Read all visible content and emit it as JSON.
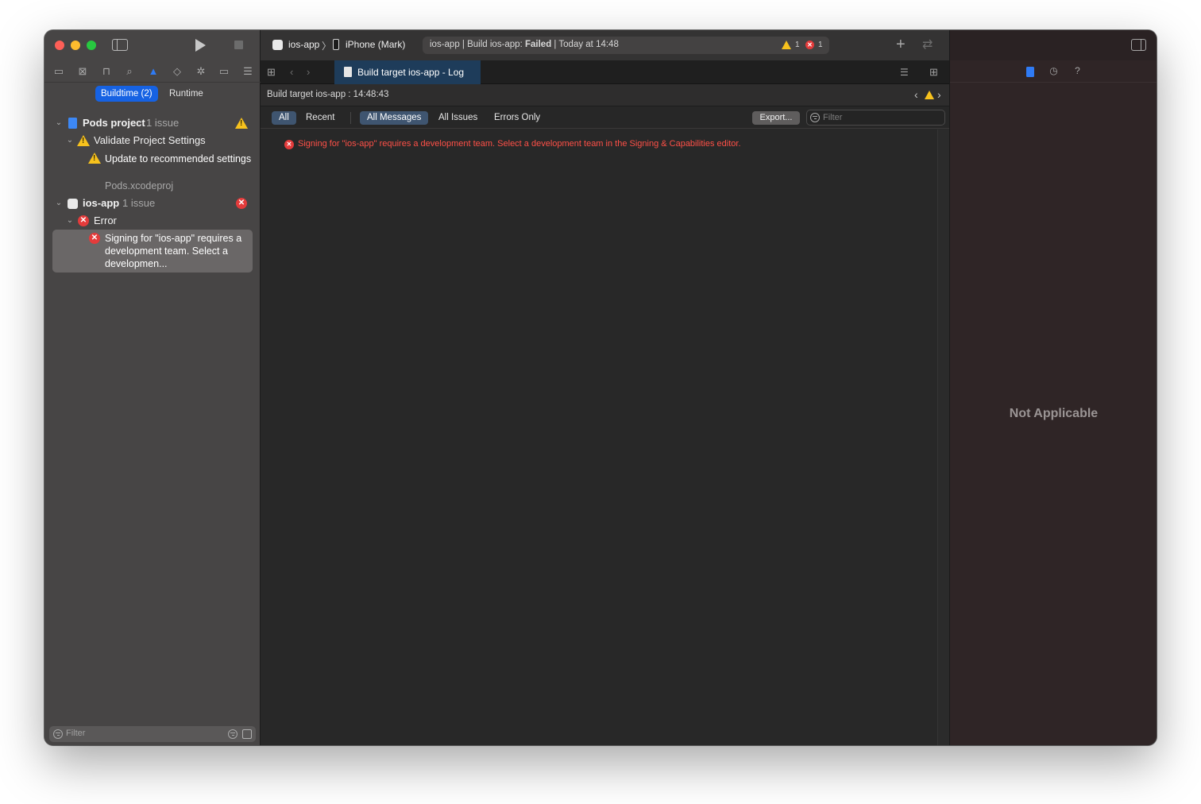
{
  "colors": {
    "accent": "#1662e3",
    "error": "#e43b3b",
    "error_text": "#ff5047",
    "warning": "#f7c21d"
  },
  "toolbar": {
    "scheme_app": "ios-app",
    "scheme_separator": "〉",
    "device": "iPhone (Mark)",
    "activity_prefix": "ios-app | Build ios-app:",
    "activity_status": "Failed",
    "activity_time": "| Today at 14:48",
    "warning_count": "1",
    "error_count": "1"
  },
  "navigator": {
    "segments": {
      "buildtime": "Buildtime (2)",
      "runtime": "Runtime"
    },
    "pods_project": {
      "name": "Pods project",
      "issues": "1 issue"
    },
    "validate_settings": "Validate Project Settings",
    "update_settings": "Update to recommended settings",
    "pods_file": "Pods.xcodeproj",
    "ios_app": {
      "name": "ios-app",
      "issues": "1 issue"
    },
    "error_group": "Error",
    "signing_error": "Signing for \"ios-app\" requires a development team. Select a developmen...",
    "filter_placeholder": "Filter"
  },
  "editor": {
    "tab_label": "Build target ios-app - Log",
    "breadcrumb": "Build target ios-app : 14:48:43",
    "scopes": {
      "all": "All",
      "recent": "Recent",
      "all_messages": "All Messages",
      "all_issues": "All Issues",
      "errors_only": "Errors Only"
    },
    "export_label": "Export...",
    "filter_placeholder": "Filter",
    "log_message": "Signing for \"ios-app\" requires a development team. Select a development team in the Signing & Capabilities editor."
  },
  "inspector": {
    "empty_text": "Not Applicable"
  },
  "icons": [
    "sidebar-toggle-icon",
    "play-icon",
    "stop-icon",
    "folder-icon",
    "source-control-icon",
    "symbol-icon",
    "search-icon",
    "issue-icon",
    "test-icon",
    "debug-icon",
    "breakpoint-icon",
    "report-icon",
    "grid-icon",
    "back-icon",
    "forward-icon",
    "document-icon",
    "editor-options-icon",
    "add-editor-icon",
    "file-inspector-icon",
    "history-icon",
    "help-icon",
    "filter-icon",
    "warning-icon",
    "error-icon"
  ]
}
